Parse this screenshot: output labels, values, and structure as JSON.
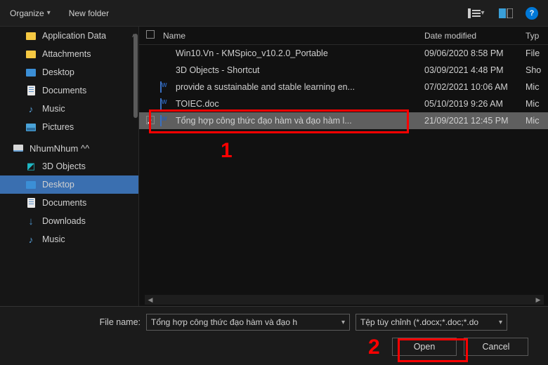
{
  "toolbar": {
    "organize": "Organize",
    "new_folder": "New folder",
    "help": "?"
  },
  "sidebar": {
    "items_top": [
      {
        "label": "Application Data",
        "icon": "folder-yellow"
      },
      {
        "label": "Attachments",
        "icon": "folder-yellow"
      },
      {
        "label": "Desktop",
        "icon": "folder-blue"
      },
      {
        "label": "Documents",
        "icon": "doc"
      },
      {
        "label": "Music",
        "icon": "music"
      },
      {
        "label": "Pictures",
        "icon": "pic"
      }
    ],
    "root": {
      "label": "NhumNhum ^^",
      "icon": "drive"
    },
    "items_bottom": [
      {
        "label": "3D Objects",
        "icon": "cube"
      },
      {
        "label": "Desktop",
        "icon": "folder-blue",
        "selected": true
      },
      {
        "label": "Documents",
        "icon": "doc"
      },
      {
        "label": "Downloads",
        "icon": "down"
      },
      {
        "label": "Music",
        "icon": "music"
      }
    ]
  },
  "list": {
    "headers": {
      "name": "Name",
      "date": "Date modified",
      "type": "Typ"
    },
    "rows": [
      {
        "icon": "folder",
        "name": "Win10.Vn - KMSpico_v10.2.0_Portable",
        "date": "09/06/2020 8:58 PM",
        "type": "File"
      },
      {
        "icon": "link",
        "name": "3D Objects - Shortcut",
        "date": "03/09/2021 4:48 PM",
        "type": "Sho"
      },
      {
        "icon": "word",
        "name": "provide a sustainable and stable learning en...",
        "date": "07/02/2021 10:06 AM",
        "type": "Mic"
      },
      {
        "icon": "word",
        "name": "TOIEC.doc",
        "date": "05/10/2019 9:26 AM",
        "type": "Mic"
      },
      {
        "icon": "word",
        "name": "Tổng hợp công thức đạo hàm và đạo hàm l...",
        "date": "21/09/2021 12:45 PM",
        "type": "Mic",
        "checked": true,
        "selected": true
      }
    ]
  },
  "bottom": {
    "filename_label": "File name:",
    "filename_value": "Tổng hợp công thức đạo hàm và đạo h",
    "filter_value": "Tệp tùy chỉnh (*.docx;*.doc;*.do",
    "open": "Open",
    "cancel": "Cancel"
  },
  "annotations": {
    "n1": "1",
    "n2": "2"
  }
}
